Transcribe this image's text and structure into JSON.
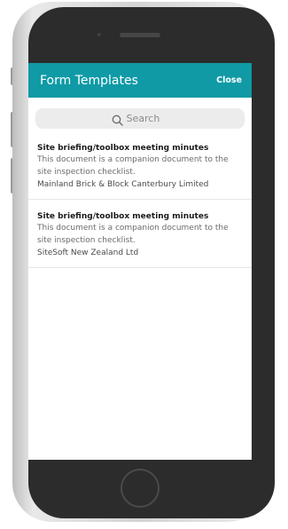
{
  "header": {
    "title": "Form Templates",
    "close_label": "Close"
  },
  "search": {
    "placeholder": "Search",
    "value": ""
  },
  "templates": [
    {
      "title": "Site briefing/toolbox meeting minutes",
      "description": "This document is a companion document to the site inspection checklist.",
      "organization": "Mainland Brick & Block Canterbury Limited"
    },
    {
      "title": "Site briefing/toolbox meeting minutes",
      "description": "This document is a companion document to the site inspection checklist.",
      "organization": "SiteSoft New Zealand Ltd"
    }
  ],
  "colors": {
    "header_bg": "#0f9aa6",
    "search_bg": "#ececec"
  }
}
